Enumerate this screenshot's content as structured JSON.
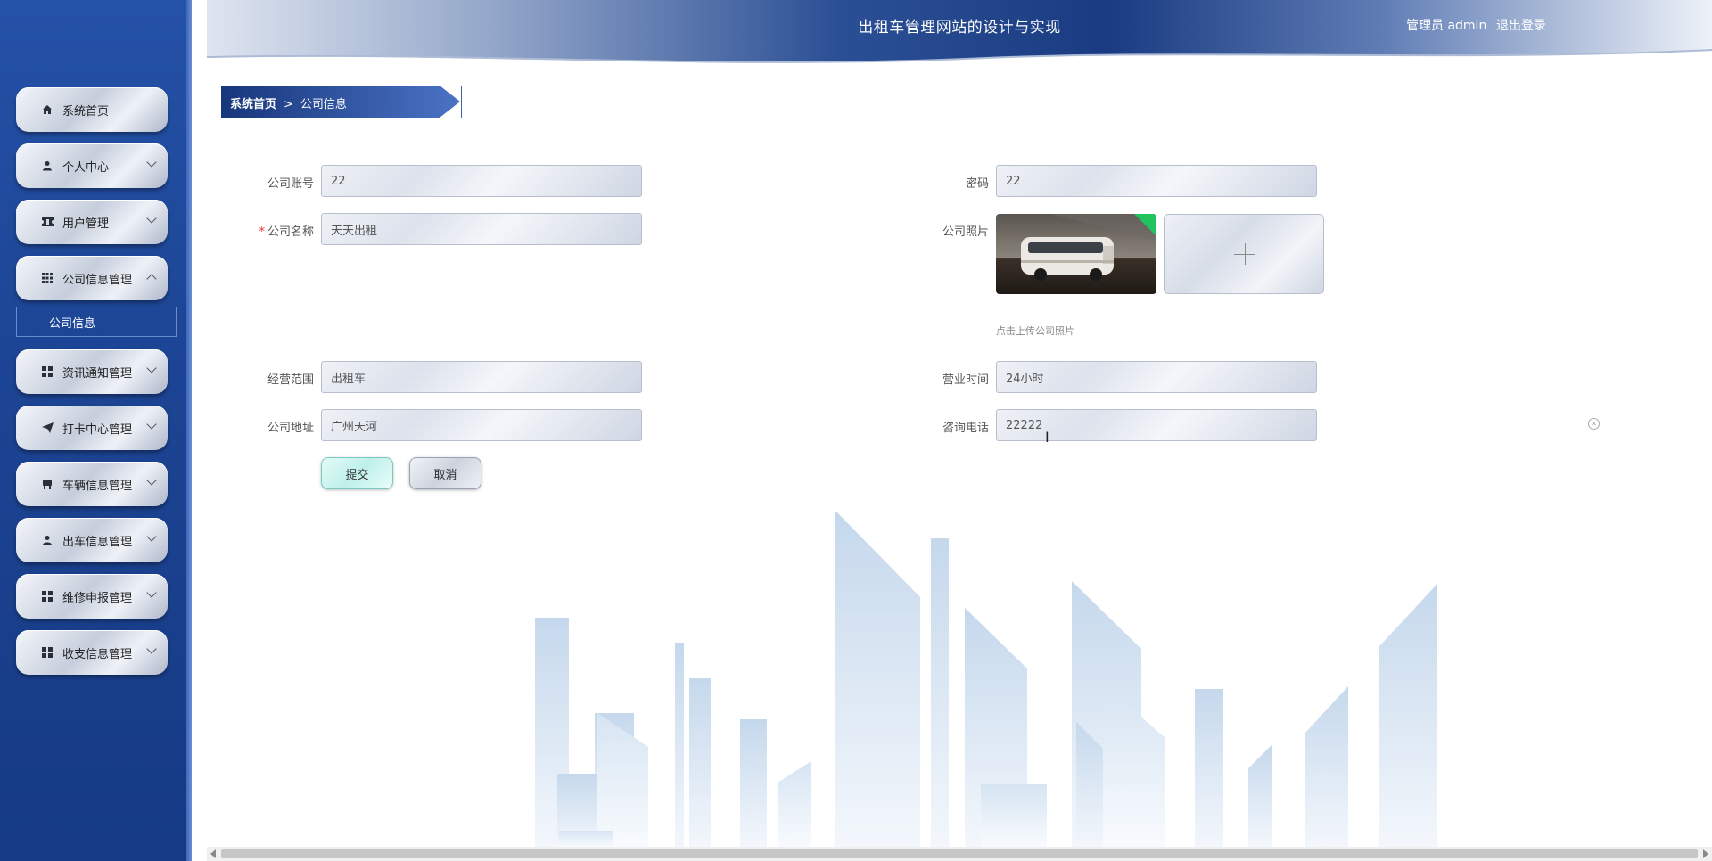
{
  "header": {
    "title": "出租车管理网站的设计与实现",
    "user": "管理员 admin",
    "logout": "退出登录"
  },
  "sidebar": {
    "items": [
      {
        "label": "系统首页",
        "icon": "home-icon",
        "arrow": "none"
      },
      {
        "label": "个人中心",
        "icon": "user-icon",
        "arrow": "down"
      },
      {
        "label": "用户管理",
        "icon": "ticket-icon",
        "arrow": "down"
      },
      {
        "label": "公司信息管理",
        "icon": "grid-icon",
        "arrow": "up",
        "expanded": true,
        "children": [
          {
            "label": "公司信息"
          }
        ]
      },
      {
        "label": "资讯通知管理",
        "icon": "apps-icon",
        "arrow": "down"
      },
      {
        "label": "打卡中心管理",
        "icon": "send-icon",
        "arrow": "down"
      },
      {
        "label": "车辆信息管理",
        "icon": "chair-icon",
        "arrow": "down"
      },
      {
        "label": "出车信息管理",
        "icon": "user-icon",
        "arrow": "down"
      },
      {
        "label": "维修申报管理",
        "icon": "apps-icon",
        "arrow": "down"
      },
      {
        "label": "收支信息管理",
        "icon": "apps-icon",
        "arrow": "down"
      }
    ]
  },
  "breadcrumb": {
    "home": "系统首页",
    "separator": ">",
    "current": "公司信息"
  },
  "form": {
    "account": {
      "label": "公司账号",
      "value": "22"
    },
    "password": {
      "label": "密码",
      "value": "22"
    },
    "name": {
      "label": "公司名称",
      "required_mark": "*",
      "value": "天天出租"
    },
    "photo": {
      "label": "公司照片",
      "hint": "点击上传公司照片"
    },
    "scope": {
      "label": "经营范围",
      "value": "出租车"
    },
    "hours": {
      "label": "营业时间",
      "value": "24小时"
    },
    "address": {
      "label": "公司地址",
      "value": "广州天河"
    },
    "phone": {
      "label": "咨询电话",
      "value": "22222"
    },
    "submit": "提交",
    "cancel": "取消"
  },
  "colors": {
    "sidebar": "#1d4595",
    "header_dark": "#1b3f86",
    "breadcrumb": "#2a4f9f",
    "accent_green": "#22c35e"
  }
}
